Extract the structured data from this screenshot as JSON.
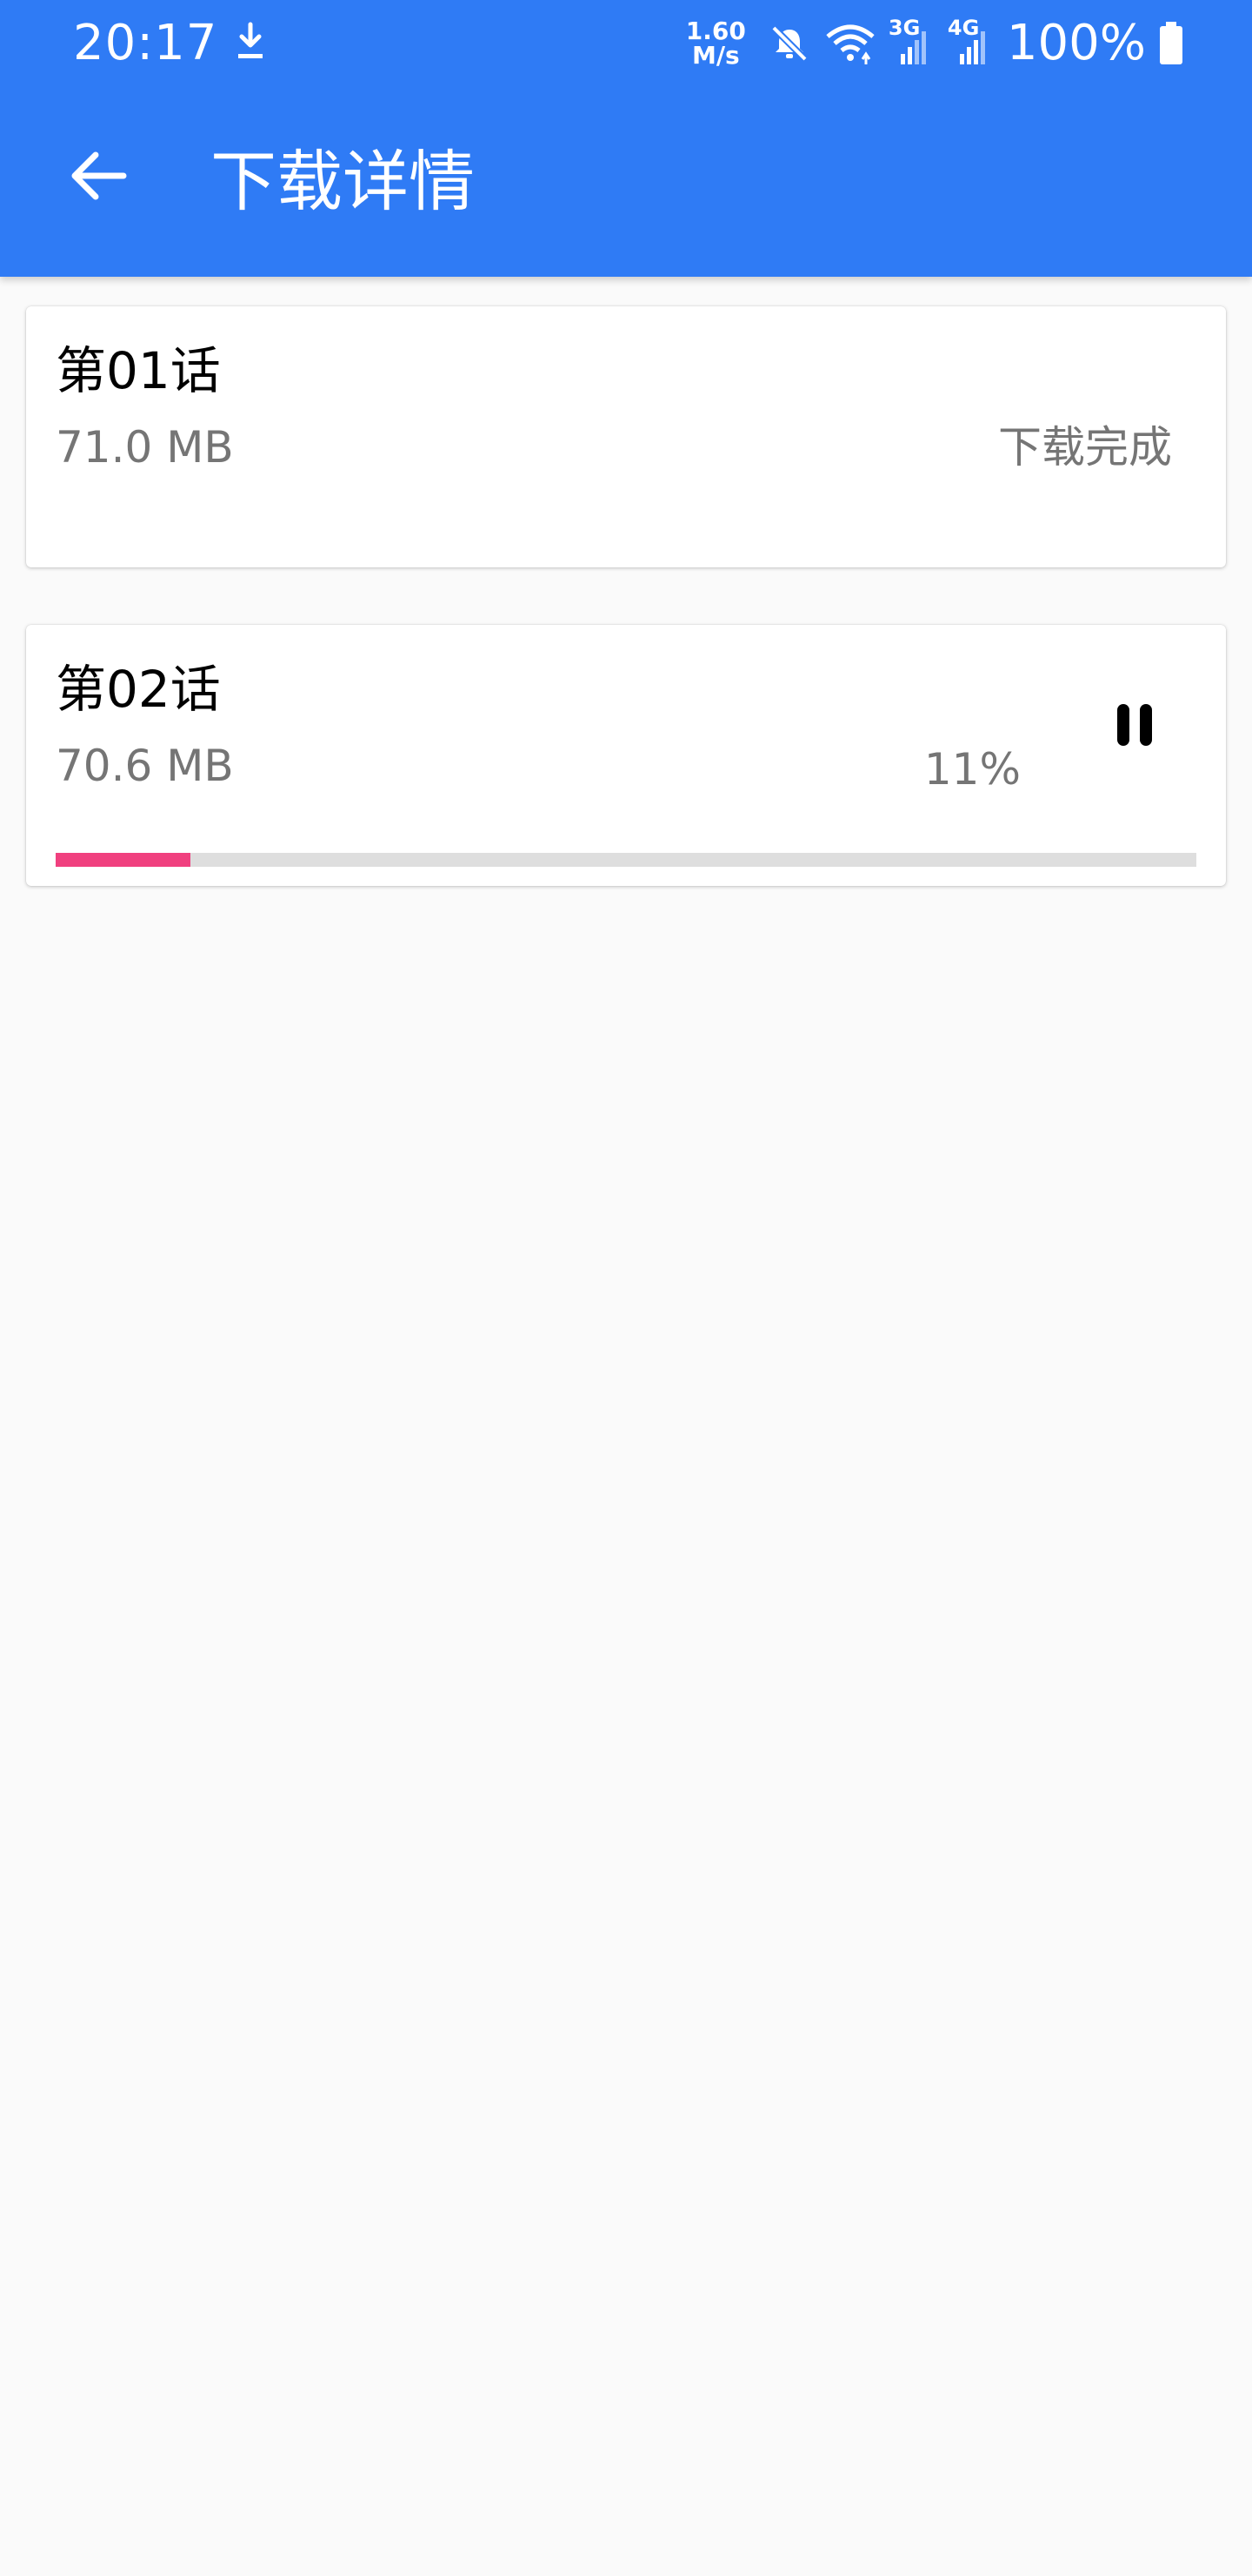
{
  "status_bar": {
    "time": "20:17",
    "net_speed_value": "1.60",
    "net_speed_unit": "M/s",
    "sim1_label": "3G",
    "sim2_label": "4G",
    "battery": "100%"
  },
  "app_bar": {
    "title": "下载详情"
  },
  "downloads": [
    {
      "title": "第01话",
      "size": "71.0 MB",
      "status": "下载完成"
    },
    {
      "title": "第02话",
      "size": "70.6 MB",
      "percent": "11%",
      "progress": 0.118
    }
  ],
  "colors": {
    "primary": "#2f7bf5",
    "progress_fill": "#f0407f",
    "progress_track": "#dedede",
    "secondary_text": "#757575",
    "background": "#fafafa"
  }
}
